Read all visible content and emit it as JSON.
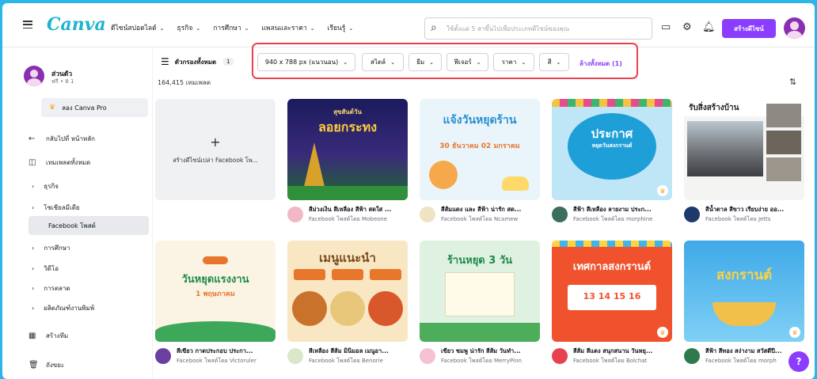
{
  "header": {
    "logo": "Canva",
    "nav": [
      "ดีไซน์สปอตไลต์",
      "ธุรกิจ",
      "การศึกษา",
      "แพลนและราคา",
      "เรียนรู้"
    ],
    "search_placeholder": "ใช้ตั้งแต่ 5 สาขึ้นไปเพื่อประเภทดีไซน์ของคุณ",
    "create_label": "สร้างดีไซน์",
    "icons": [
      "desktop-icon",
      "gear-icon",
      "bell-icon"
    ]
  },
  "sidebar": {
    "account_name": "ส่วนตัว",
    "account_sub": "ฟรี • 8 1",
    "pro_label": "ลอง Canva Pro",
    "back_label": "กลับไปที่ หน้าหลัก",
    "all_templates": "เทมเพลตทั้งหมด",
    "categories": [
      "ธุรกิจ",
      "โซเชียลมีเดีย"
    ],
    "active": "Facebook โพสต์",
    "categories2": [
      "การศึกษา",
      "วิดีโอ",
      "การตลาด",
      "ผลิตภัณฑ์งานพิมพ์"
    ],
    "create_team": "สร้างทีม",
    "trash": "ถังขยะ"
  },
  "filters": {
    "all_label": "ตัวกรองทั้งหมด",
    "all_count": "1",
    "result_count": "164,415 เทมเพลต",
    "chips": [
      "940 x 788 px (แนวนอน)",
      "สไตล์",
      "ธีม",
      "ฟีเจอร์",
      "ราคา",
      "สี"
    ],
    "clear_label": "ล้างทั้งหมด (1)"
  },
  "blank_card": {
    "label": "สร้างดีไซน์เปล่า Facebook โพ..."
  },
  "templates": [
    {
      "title": "สีม่วงเงิน สีเหลือง สีฟ้า สดใส ...",
      "sub": "Facebook โพสต์โดย Mobeone",
      "thumb": "ลอยกระทง",
      "thumb_sub": "สุขสันต์วัน"
    },
    {
      "title": "สีส้มแดง และ สีฟ้า น่ารัก สด...",
      "sub": "Facebook โพสต์โดย Ncamew",
      "thumb": "แจ้งวันหยุดร้าน",
      "thumb_sub": "30 ธันวาคม  02 มกราคม"
    },
    {
      "title": "สีฟ้า สีเหลือง ลายงาม ประก...",
      "sub": "Facebook โพสต์โดย morphine",
      "thumb": "ประกาศ",
      "thumb_sub": "หยุดวันสงกรานต์"
    },
    {
      "title": "สีน้ำตาล สีขาว เรียบง่าย ออ...",
      "sub": "Facebook โพสต์โดย Jetts",
      "thumb": "รับสิ่งสร้างบ้าน",
      "thumb_sub": ""
    },
    {
      "title": "สีเขียว กาดประกอบ ประกา...",
      "sub": "Facebook โพสต์โดย Victoruler",
      "thumb": "วันหยุดแรงงาน",
      "thumb_sub": "1 พฤษภาคม"
    },
    {
      "title": "สีเหลือง สีส้ม มินิมอล เมนูอา...",
      "sub": "Facebook โพสต์โดย Benorie",
      "thumb": "เมนูแนะนำ",
      "thumb_sub": ""
    },
    {
      "title": "เขียว ชมพู น่ารัก สีส้ม วันทำ...",
      "sub": "Facebook โพสต์โดย MerryPinn",
      "thumb": "ร้านหยุด 3 วัน",
      "thumb_sub": ""
    },
    {
      "title": "สีส้ม สีแดง สนุกสนาน วันหยุ...",
      "sub": "Facebook โพสต์โดย Bolchat",
      "thumb": "เทศกาลสงกรานต์",
      "thumb_sub": "13  14  15  16"
    },
    {
      "title": "สีฟ้า สีทอง สง่างาม สวัสดีปี...",
      "sub": "Facebook โพสต์โดย morph",
      "thumb": "สงกรานต์",
      "thumb_sub": ""
    }
  ],
  "colors": {
    "accent": "#8b3dff",
    "highlight": "#e8424f",
    "frame": "#2cb5e8"
  }
}
